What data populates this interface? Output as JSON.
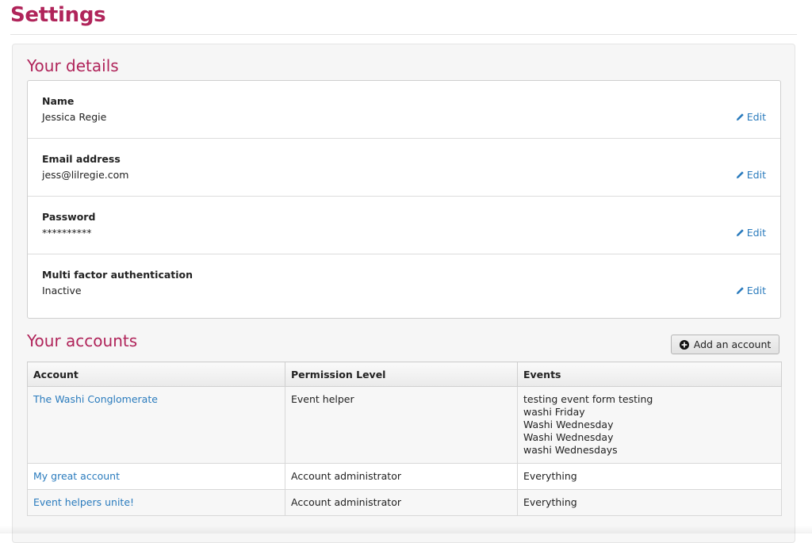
{
  "page": {
    "title": "Settings"
  },
  "details": {
    "heading": "Your details",
    "edit_label": "Edit",
    "rows": [
      {
        "label": "Name",
        "value": "Jessica Regie"
      },
      {
        "label": "Email address",
        "value": "jess@lilregie.com"
      },
      {
        "label": "Password",
        "value": "**********"
      },
      {
        "label": "Multi factor authentication",
        "value": "Inactive"
      }
    ]
  },
  "accounts": {
    "heading": "Your accounts",
    "add_button_label": "Add an account",
    "columns": [
      "Account",
      "Permission Level",
      "Events"
    ],
    "rows": [
      {
        "account": "The Washi Conglomerate",
        "permission": "Event helper",
        "events": [
          "testing event form testing",
          "washi Friday",
          "Washi Wednesday",
          "Washi Wednesday",
          "washi Wednesdays"
        ]
      },
      {
        "account": "My great account",
        "permission": "Account administrator",
        "events": [
          "Everything"
        ]
      },
      {
        "account": "Event helpers unite!",
        "permission": "Account administrator",
        "events": [
          "Everything"
        ]
      }
    ]
  },
  "icons": {
    "edit": "pencil-icon",
    "add": "plus-circle-icon"
  },
  "colors": {
    "accent": "#b0245a",
    "link": "#2a7bbd"
  }
}
